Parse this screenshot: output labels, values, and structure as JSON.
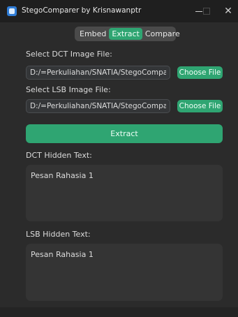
{
  "window": {
    "title": "StegoComparer by Krisnawanptr",
    "close_glyph": "✕"
  },
  "tabs": [
    {
      "label": "Embed",
      "active": false
    },
    {
      "label": "Extract",
      "active": true
    },
    {
      "label": "Compare",
      "active": false
    }
  ],
  "dct": {
    "label": "Select DCT Image File:",
    "path": "D:/=Perkuliahan/SNATIA/StegoComparer",
    "choose_label": "Choose File"
  },
  "lsb": {
    "label": "Select LSB Image File:",
    "path": "D:/=Perkuliahan/SNATIA/StegoComparer",
    "choose_label": "Choose File"
  },
  "extract_label": "Extract",
  "dct_hidden": {
    "label": "DCT Hidden Text:",
    "text": "Pesan Rahasia 1"
  },
  "lsb_hidden": {
    "label": "LSB Hidden Text:",
    "text": "Pesan Rahasia 1"
  },
  "colors": {
    "accent": "#2fa572",
    "background": "#2b2b2b",
    "titlebar": "#1f1f1f",
    "field": "#343638"
  }
}
